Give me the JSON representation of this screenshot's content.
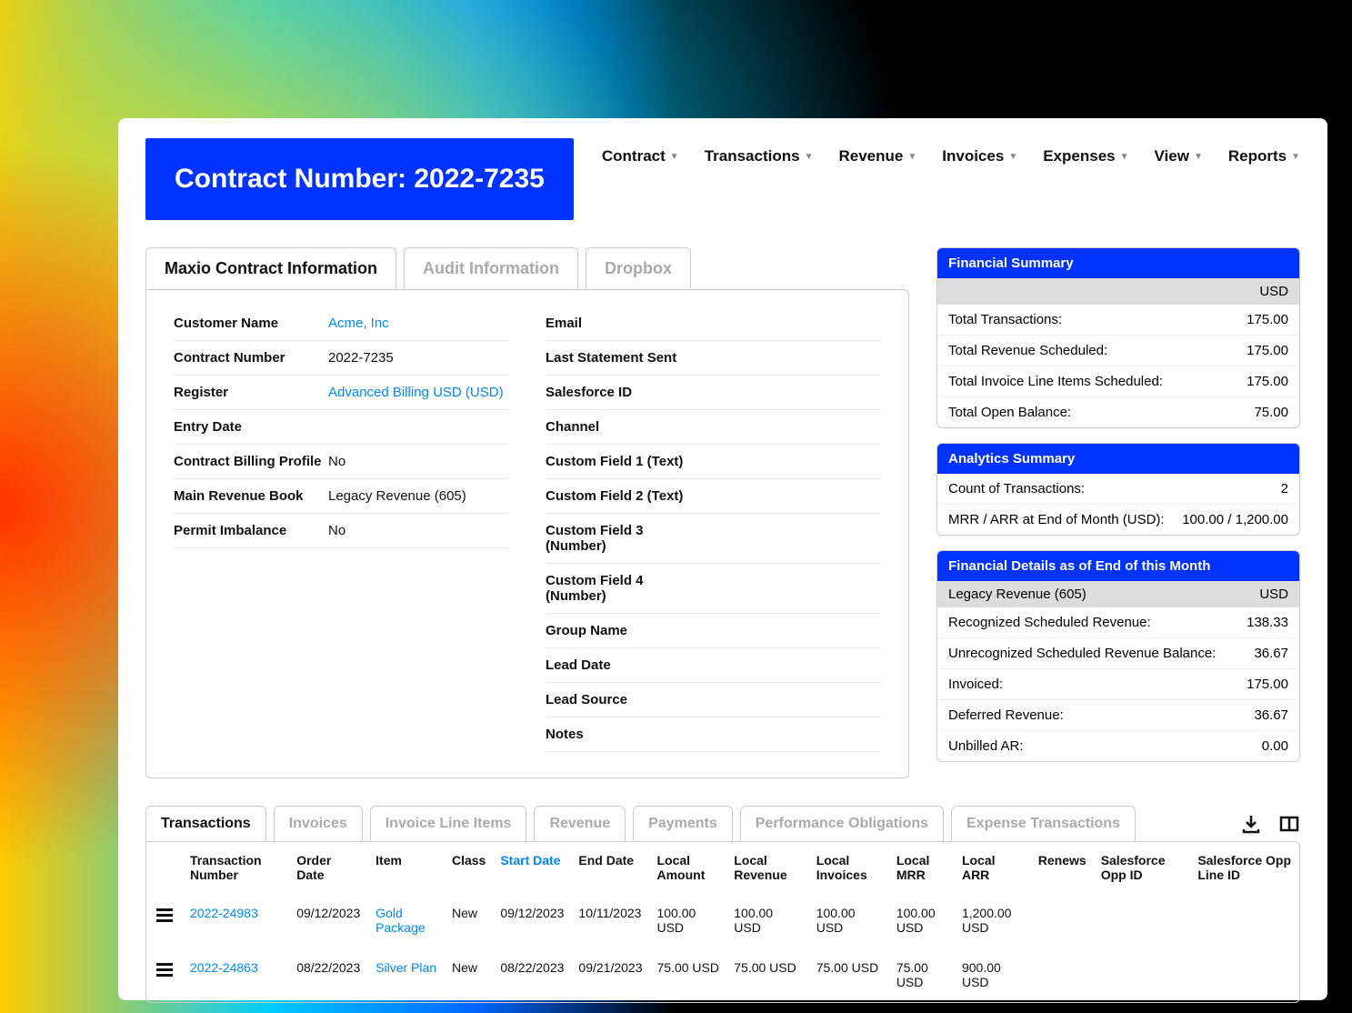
{
  "title": "Contract Number: 2022-7235",
  "nav": [
    "Contract",
    "Transactions",
    "Revenue",
    "Invoices",
    "Expenses",
    "View",
    "Reports"
  ],
  "info_tabs": [
    "Maxio Contract Information",
    "Audit Information",
    "Dropbox"
  ],
  "info_left": [
    {
      "label": "Customer Name",
      "value": "Acme, Inc",
      "link": true
    },
    {
      "label": "Contract Number",
      "value": "2022-7235"
    },
    {
      "label": "Register",
      "value": "Advanced Billing USD (USD)",
      "link": true
    },
    {
      "label": "Entry Date",
      "value": ""
    },
    {
      "label": "Contract Billing Profile",
      "value": "No"
    },
    {
      "label": "Main Revenue Book",
      "value": "Legacy Revenue (605)"
    },
    {
      "label": "Permit Imbalance",
      "value": "No"
    }
  ],
  "info_right": [
    {
      "label": "Email",
      "value": ""
    },
    {
      "label": "Last Statement Sent",
      "value": ""
    },
    {
      "label": "Salesforce ID",
      "value": ""
    },
    {
      "label": "Channel",
      "value": ""
    },
    {
      "label": "Custom Field 1 (Text)",
      "value": ""
    },
    {
      "label": "Custom Field 2 (Text)",
      "value": ""
    },
    {
      "label": "Custom Field 3 (Number)",
      "value": ""
    },
    {
      "label": "Custom Field 4 (Number)",
      "value": ""
    },
    {
      "label": "Group Name",
      "value": ""
    },
    {
      "label": "Lead Date",
      "value": ""
    },
    {
      "label": "Lead Source",
      "value": ""
    },
    {
      "label": "Notes",
      "value": ""
    }
  ],
  "fin_summary": {
    "title": "Financial Summary",
    "currency": "USD",
    "rows": [
      {
        "label": "Total Transactions:",
        "value": "175.00"
      },
      {
        "label": "Total Revenue Scheduled:",
        "value": "175.00"
      },
      {
        "label": "Total Invoice Line Items Scheduled:",
        "value": "175.00"
      },
      {
        "label": "Total Open Balance:",
        "value": "75.00"
      }
    ]
  },
  "analytics": {
    "title": "Analytics Summary",
    "rows": [
      {
        "label": "Count of Transactions:",
        "value": "2"
      },
      {
        "label": "MRR / ARR at End of Month (USD):",
        "value": "100.00 / 1,200.00"
      }
    ]
  },
  "fin_details": {
    "title": "Financial Details as of End of this Month",
    "sub_left": "Legacy Revenue (605)",
    "sub_right": "USD",
    "rows": [
      {
        "label": "Recognized Scheduled Revenue:",
        "value": "138.33"
      },
      {
        "label": "Unrecognized Scheduled Revenue Balance:",
        "value": "36.67"
      },
      {
        "label": "Invoiced:",
        "value": "175.00"
      },
      {
        "label": "Deferred Revenue:",
        "value": "36.67"
      },
      {
        "label": "Unbilled AR:",
        "value": "0.00"
      }
    ]
  },
  "bottom_tabs": [
    "Transactions",
    "Invoices",
    "Invoice Line Items",
    "Revenue",
    "Payments",
    "Performance Obligations",
    "Expense Transactions"
  ],
  "table": {
    "headers": [
      "Transaction Number",
      "Order Date",
      "Item",
      "Class",
      "Start Date",
      "End Date",
      "Local Amount",
      "Local Revenue",
      "Local Invoices",
      "Local MRR",
      "Local ARR",
      "Renews",
      "Salesforce Opp ID",
      "Salesforce Opp Line ID"
    ],
    "sorted_col": 4,
    "rows": [
      {
        "tx": "2022-24983",
        "order": "09/12/2023",
        "item": "Gold Package",
        "class": "New",
        "start": "09/12/2023",
        "end": "10/11/2023",
        "amt": "100.00 USD",
        "rev": "100.00 USD",
        "inv": "100.00 USD",
        "mrr": "100.00 USD",
        "arr": "1,200.00 USD",
        "renews": "",
        "oppid": "",
        "opplineid": ""
      },
      {
        "tx": "2022-24863",
        "order": "08/22/2023",
        "item": "Silver Plan",
        "class": "New",
        "start": "08/22/2023",
        "end": "09/21/2023",
        "amt": "75.00 USD",
        "rev": "75.00 USD",
        "inv": "75.00 USD",
        "mrr": "75.00 USD",
        "arr": "900.00 USD",
        "renews": "",
        "oppid": "",
        "opplineid": ""
      }
    ]
  }
}
